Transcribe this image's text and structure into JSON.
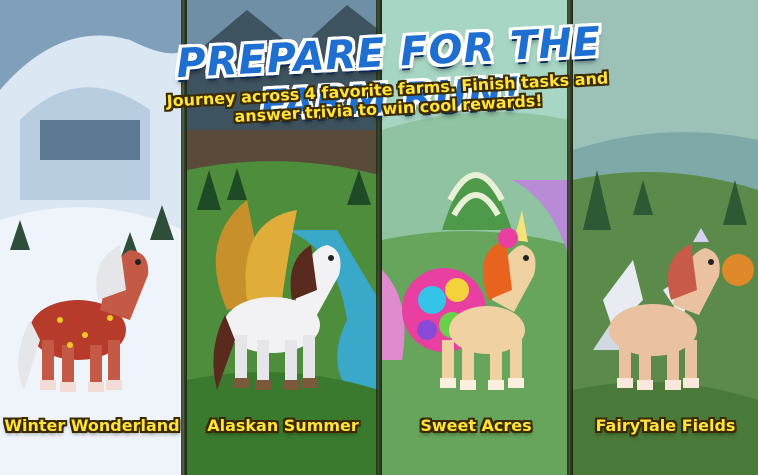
{
  "banner": {
    "title": "PREPARE FOR THE FARM RUN!",
    "subtitle_line1": "Journey across 4 favorite farms. Finish tasks and",
    "subtitle_line2": "answer trivia to win cool rewards!"
  },
  "farms": [
    {
      "name": "Winter Wonderland",
      "horse_icon": "festive-winter-horse",
      "background": "snowy-mountain"
    },
    {
      "name": "Alaskan Summer",
      "horse_icon": "winged-pegasus-horse",
      "background": "green-valley-lake"
    },
    {
      "name": "Sweet Acres",
      "horse_icon": "candy-unicorn-horse",
      "background": "candy-land"
    },
    {
      "name": "FairyTale Fields",
      "horse_icon": "fairy-tiara-horse",
      "background": "fairytale-meadow"
    }
  ],
  "colors": {
    "title_blue": "#1e6fd0",
    "label_yellow": "#ffe23a",
    "winter_bg": "#8fb0c9",
    "alaska_bg": "#3f7d3a",
    "sweet_bg": "#6fb07a",
    "fairy_bg": "#5b8a4a"
  }
}
